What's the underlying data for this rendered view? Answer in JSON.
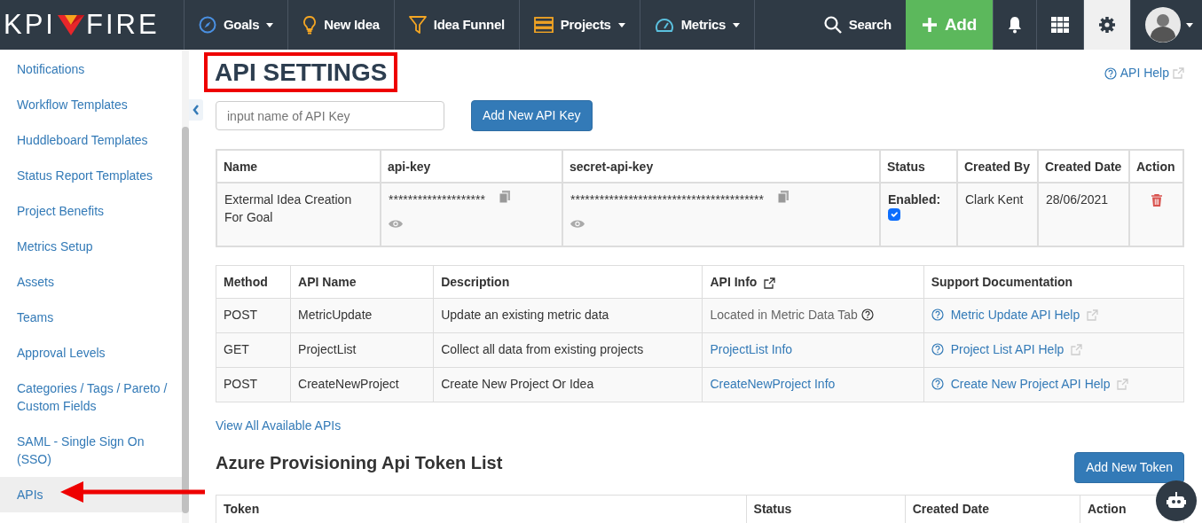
{
  "navbar": {
    "logo": {
      "left": "KPI",
      "right": "FIRE"
    },
    "items": [
      {
        "label": "Goals",
        "dropdown": true
      },
      {
        "label": "New Idea",
        "dropdown": false
      },
      {
        "label": "Idea Funnel",
        "dropdown": false
      },
      {
        "label": "Projects",
        "dropdown": true
      },
      {
        "label": "Metrics",
        "dropdown": true
      }
    ],
    "search": "Search",
    "add": "Add",
    "settings_selected": true
  },
  "sidebar": {
    "items": [
      {
        "label": "Notifications",
        "selected": false
      },
      {
        "label": "Workflow Templates",
        "selected": false
      },
      {
        "label": "Huddleboard Templates",
        "selected": false
      },
      {
        "label": "Status Report Templates",
        "selected": false
      },
      {
        "label": "Project Benefits",
        "selected": false
      },
      {
        "label": "Metrics Setup",
        "selected": false
      },
      {
        "label": "Assets",
        "selected": false
      },
      {
        "label": "Teams",
        "selected": false
      },
      {
        "label": "Approval Levels",
        "selected": false
      },
      {
        "label": "Categories / Tags / Pareto / Custom Fields",
        "selected": false
      },
      {
        "label": "SAML - Single Sign On (SSO)",
        "selected": false
      },
      {
        "label": "APIs",
        "selected": true
      }
    ]
  },
  "page": {
    "title": "API SETTINGS",
    "help_link": "API Help",
    "key_input": {
      "placeholder": "input name of API Key"
    },
    "add_key_button": "Add New API Key"
  },
  "keys_table": {
    "columns": [
      "Name",
      "api-key",
      "secret-api-key",
      "Status",
      "Created By",
      "Created Date",
      "Action"
    ],
    "rows": [
      {
        "name": "Extermal Idea Creation For Goal",
        "api_key": "********************",
        "secret_api_key": "****************************************",
        "status_label": "Enabled:",
        "enabled": true,
        "created_by": "Clark Kent",
        "created_date": "28/06/2021"
      }
    ]
  },
  "apis_table": {
    "columns": [
      "Method",
      "API Name",
      "Description",
      "API Info",
      "Support Documentation"
    ],
    "rows": [
      {
        "method": "POST",
        "api_name": "MetricUpdate",
        "description": "Update an existing metric data",
        "api_info": {
          "text": "Located in Metric Data Tab",
          "kind": "note"
        },
        "support": "Metric Update API Help"
      },
      {
        "method": "GET",
        "api_name": "ProjectList",
        "description": "Collect all data from existing projects",
        "api_info": {
          "text": "ProjectList Info",
          "kind": "link"
        },
        "support": "Project List API Help"
      },
      {
        "method": "POST",
        "api_name": "CreateNewProject",
        "description": "Create New Project Or Idea",
        "api_info": {
          "text": "CreateNewProject Info",
          "kind": "link"
        },
        "support": "Create New Project API Help"
      }
    ]
  },
  "view_all_link": "View All Available APIs",
  "token_section": {
    "title": "Azure Provisioning Api Token List",
    "add_button": "Add New Token",
    "columns": [
      "Token",
      "Status",
      "Created Date",
      "Action"
    ]
  }
}
